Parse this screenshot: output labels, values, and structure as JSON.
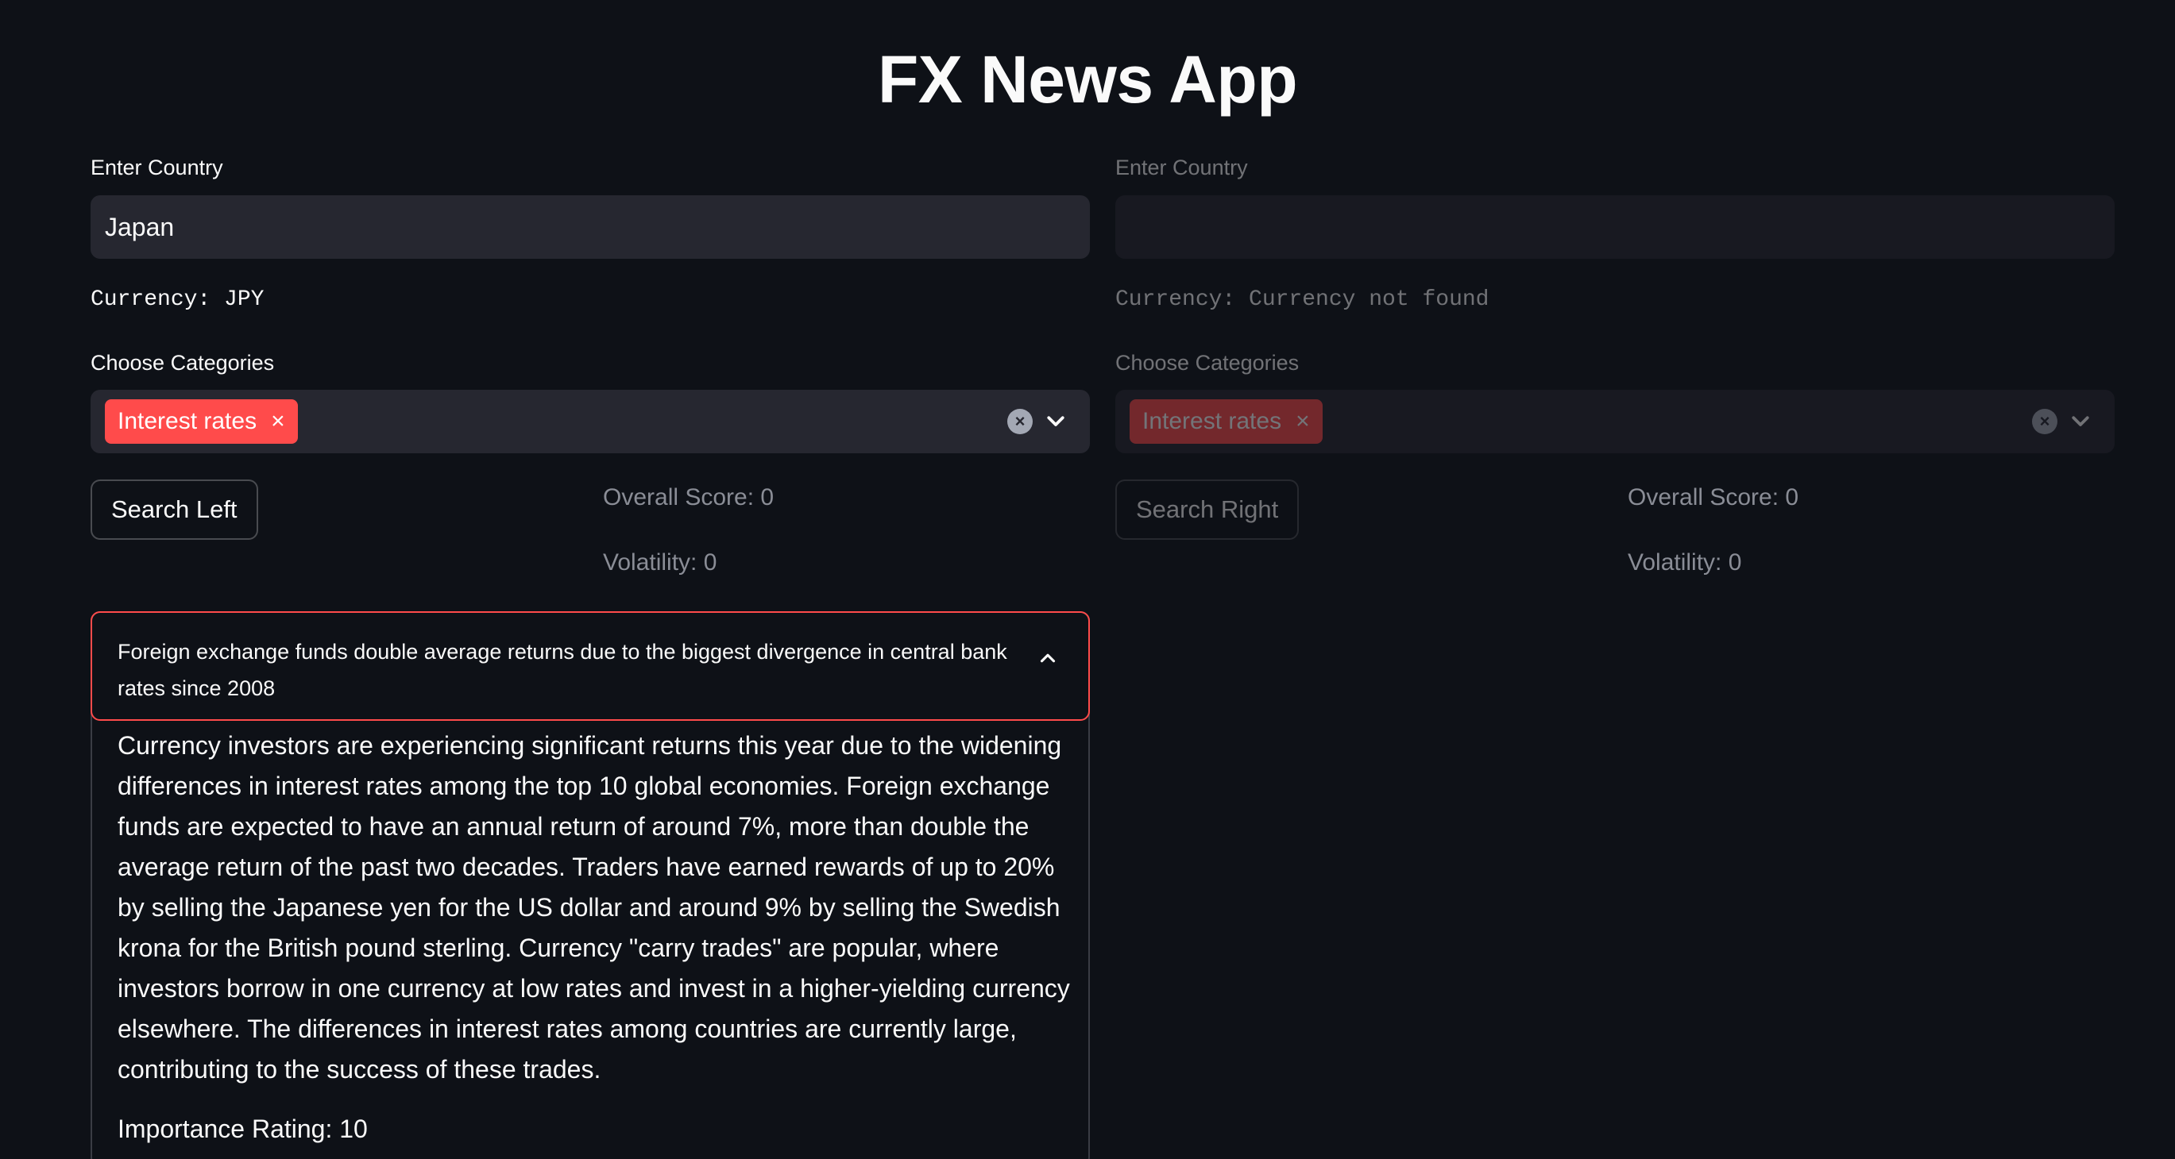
{
  "app": {
    "title": "FX News App"
  },
  "left": {
    "country_label": "Enter Country",
    "country_value": "Japan",
    "currency_text": "Currency: JPY",
    "categories_label": "Choose Categories",
    "selected_category": "Interest rates",
    "search_button": "Search Left",
    "overall_score": "Overall Score: 0",
    "volatility": "Volatility: 0"
  },
  "right": {
    "country_label": "Enter Country",
    "country_value": "",
    "currency_text": "Currency: Currency not found",
    "categories_label": "Choose Categories",
    "selected_category": "Interest rates",
    "search_button": "Search Right",
    "overall_score": "Overall Score: 0",
    "volatility": "Volatility: 0"
  },
  "article": {
    "title": "Foreign exchange funds double average returns due to the biggest divergence in central bank rates since 2008",
    "body": "Currency investors are experiencing significant returns this year due to the widening differences in interest rates among the top 10 global economies. Foreign exchange funds are expected to have an annual return of around 7%, more than double the average return of the past two decades. Traders have earned rewards of up to 20% by selling the Japanese yen for the US dollar and around 9% by selling the Swedish krona for the British pound sterling. Currency \"carry trades\" are popular, where investors borrow in one currency at low rates and invest in a higher-yielding currency elsewhere. The differences in interest rates among countries are currently large, contributing to the success of these trades.",
    "importance": "Importance Rating: 10"
  },
  "icons": {
    "tag_remove": "×",
    "clear_all": "×"
  },
  "colors": {
    "background": "#0e1117",
    "input_bg": "#262730",
    "accent": "#ff4b4b"
  }
}
